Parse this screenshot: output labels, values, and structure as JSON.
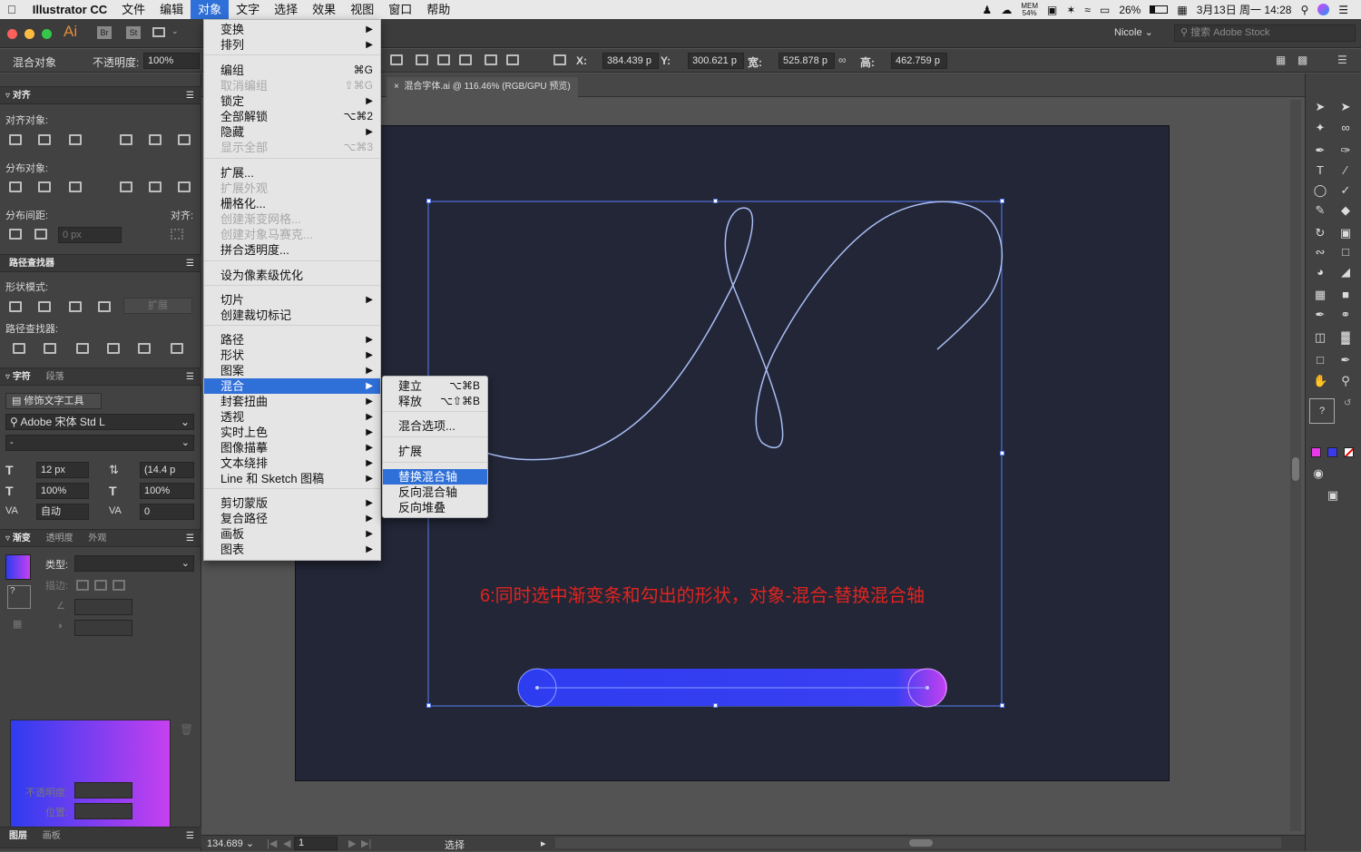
{
  "menubar": {
    "app_name": "Illustrator CC",
    "menus": [
      "文件",
      "编辑",
      "对象",
      "文字",
      "选择",
      "效果",
      "视图",
      "窗口",
      "帮助"
    ],
    "active_menu": "对象",
    "status": {
      "mem": "MEM",
      "mem_percent": "54%",
      "battery": "26%",
      "datetime": "3月13日 周一  14:28"
    }
  },
  "titlebar": {
    "app_logo": "Ai",
    "bridge": "Br",
    "stock": "St",
    "user": "Nicole",
    "search_placeholder": "搜索 Adobe Stock"
  },
  "control_bar": {
    "object_type": "混合对象",
    "opacity_label": "不透明度:",
    "opacity_value": "100%",
    "x_label": "X:",
    "x_value": "384.439 p",
    "y_label": "Y:",
    "y_value": "300.621 p",
    "w_label": "宽:",
    "w_value": "525.878 p",
    "h_label": "高:",
    "h_value": "462.759 p"
  },
  "document_tab": {
    "title": "混合字体.ai @ 116.46% (RGB/GPU 预览)"
  },
  "align_panel": {
    "title": "对齐",
    "align_objects": "对齐对象:",
    "distribute_objects": "分布对象:",
    "distribute_spacing": "分布间距:",
    "align_to": "对齐:",
    "spacing_value": "0 px"
  },
  "pathfinder_panel": {
    "title": "路径查找器",
    "shape_modes": "形状模式:",
    "expand": "扩展",
    "pathfinders": "路径查找器:"
  },
  "character_panel": {
    "tab_character": "字符",
    "tab_paragraph": "段落",
    "touch_type": "修饰文字工具",
    "font_family": "Adobe 宋体 Std L",
    "font_style": "-",
    "font_size": "12 px",
    "leading": "(14.4 p",
    "vertical_scale": "100%",
    "horizontal_scale": "100%",
    "kerning": "自动",
    "tracking": "0"
  },
  "gradient_panel": {
    "tab_gradient": "渐变",
    "tab_transparency": "透明度",
    "tab_appearance": "外观",
    "type_label": "类型:",
    "stroke_label": "描边:",
    "opacity_label": "不透明度:",
    "location_label": "位置:"
  },
  "bottom_tabs": {
    "layers": "图层",
    "artboards": "画板"
  },
  "status_bar": {
    "zoom": "134.689",
    "page": "1",
    "tool": "选择"
  },
  "object_menu": {
    "items": [
      {
        "label": "变换",
        "submenu": true
      },
      {
        "label": "排列",
        "submenu": true
      },
      {
        "label": "编组",
        "shortcut": "⌘G"
      },
      {
        "label": "取消编组",
        "shortcut": "⇧⌘G",
        "disabled": true
      },
      {
        "label": "锁定",
        "submenu": true
      },
      {
        "label": "全部解锁",
        "shortcut": "⌥⌘2"
      },
      {
        "label": "隐藏",
        "submenu": true
      },
      {
        "label": "显示全部",
        "shortcut": "⌥⌘3",
        "disabled": true
      },
      {
        "label": "扩展..."
      },
      {
        "label": "扩展外观",
        "disabled": true
      },
      {
        "label": "栅格化..."
      },
      {
        "label": "创建渐变网格...",
        "disabled": true
      },
      {
        "label": "创建对象马赛克...",
        "disabled": true
      },
      {
        "label": "拼合透明度..."
      },
      {
        "label": "设为像素级优化"
      },
      {
        "label": "切片",
        "submenu": true
      },
      {
        "label": "创建裁切标记"
      },
      {
        "label": "路径",
        "submenu": true
      },
      {
        "label": "形状",
        "submenu": true
      },
      {
        "label": "图案",
        "submenu": true
      },
      {
        "label": "混合",
        "submenu": true,
        "highlighted": true
      },
      {
        "label": "封套扭曲",
        "submenu": true
      },
      {
        "label": "透视",
        "submenu": true
      },
      {
        "label": "实时上色",
        "submenu": true
      },
      {
        "label": "图像描摹",
        "submenu": true
      },
      {
        "label": "文本绕排",
        "submenu": true
      },
      {
        "label": "Line 和 Sketch 图稿",
        "submenu": true
      },
      {
        "label": "剪切蒙版",
        "submenu": true
      },
      {
        "label": "复合路径",
        "submenu": true
      },
      {
        "label": "画板",
        "submenu": true
      },
      {
        "label": "图表",
        "submenu": true
      }
    ]
  },
  "blend_submenu": {
    "items": [
      {
        "label": "建立",
        "shortcut": "⌥⌘B"
      },
      {
        "label": "释放",
        "shortcut": "⌥⇧⌘B"
      },
      {
        "label": "混合选项..."
      },
      {
        "label": "扩展"
      },
      {
        "label": "替换混合轴",
        "highlighted": true
      },
      {
        "label": "反向混合轴"
      },
      {
        "label": "反向堆叠"
      }
    ]
  },
  "canvas": {
    "caption": "6:同时选中渐变条和勾出的形状，对象-混合-替换混合轴",
    "colors": {
      "artboard": "#222636",
      "stroke": "#a9bdf5",
      "gradient_start": "#2e3cf0",
      "gradient_end": "#c640f0",
      "caption": "#e0241f",
      "selection": "#5b7ff5"
    }
  }
}
